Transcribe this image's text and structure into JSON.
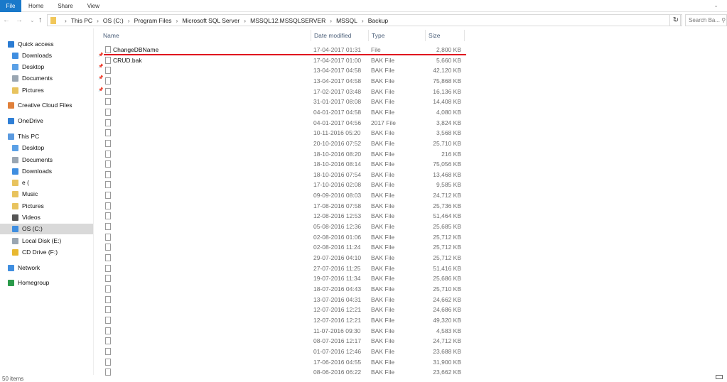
{
  "ribbon": {
    "tabs": [
      "File",
      "Home",
      "Share",
      "View"
    ]
  },
  "address": {
    "crumbs": [
      "This PC",
      "OS (C:)",
      "Program Files",
      "Microsoft SQL Server",
      "MSSQL12.MSSQLSERVER",
      "MSSQL",
      "Backup"
    ],
    "search_placeholder": "Search Ba..."
  },
  "sidebar": [
    {
      "label": "Quick access",
      "color": "#2b7cd3",
      "indent": 0,
      "pin": false
    },
    {
      "label": "Downloads",
      "color": "#3f8ee0",
      "indent": 1,
      "pin": true
    },
    {
      "label": "Desktop",
      "color": "#5aa0e6",
      "indent": 1,
      "pin": true
    },
    {
      "label": "Documents",
      "color": "#9aa6b2",
      "indent": 1,
      "pin": true
    },
    {
      "label": "Pictures",
      "color": "#e8c35e",
      "indent": 1,
      "pin": true
    },
    {
      "label": "Creative Cloud Files",
      "color": "#e0803a",
      "indent": 0,
      "pin": false
    },
    {
      "label": "OneDrive",
      "color": "#2f7fd6",
      "indent": 0,
      "pin": false
    },
    {
      "label": "This PC",
      "color": "#5a9ae0",
      "indent": 0,
      "pin": false
    },
    {
      "label": "Desktop",
      "color": "#5aa0e6",
      "indent": 1,
      "pin": false
    },
    {
      "label": "Documents",
      "color": "#9aa6b2",
      "indent": 1,
      "pin": false
    },
    {
      "label": "Downloads",
      "color": "#3f8ee0",
      "indent": 1,
      "pin": false
    },
    {
      "label": "e (",
      "color": "#e8c35e",
      "indent": 1,
      "pin": false
    },
    {
      "label": "Music",
      "color": "#e8c35e",
      "indent": 1,
      "pin": false
    },
    {
      "label": "Pictures",
      "color": "#e8c35e",
      "indent": 1,
      "pin": false
    },
    {
      "label": "Videos",
      "color": "#555555",
      "indent": 1,
      "pin": false
    },
    {
      "label": "OS (C:)",
      "color": "#3f8ee0",
      "indent": 1,
      "pin": false,
      "selected": true
    },
    {
      "label": "Local Disk (E:)",
      "color": "#9aa6b2",
      "indent": 1,
      "pin": false
    },
    {
      "label": "CD Drive (F:)",
      "color": "#e8b830",
      "indent": 1,
      "pin": false
    },
    {
      "label": "Network",
      "color": "#3f8ee0",
      "indent": 0,
      "pin": false
    },
    {
      "label": "Homegroup",
      "color": "#2b9a4a",
      "indent": 0,
      "pin": false
    }
  ],
  "columns": [
    "Name",
    "Date modified",
    "Type",
    "Size"
  ],
  "files": [
    [
      "ChangeDBName",
      "17-04-2017 01:31",
      "File",
      "2,800 KB"
    ],
    [
      "CRUD.bak",
      "17-04-2017 01:00",
      "BAK File",
      "5,660 KB"
    ],
    [
      "",
      "13-04-2017 04:58",
      "BAK File",
      "42,120 KB"
    ],
    [
      "",
      "13-04-2017 04:58",
      "BAK File",
      "75,868 KB"
    ],
    [
      "",
      "17-02-2017 03:48",
      "BAK File",
      "16,136 KB"
    ],
    [
      "",
      "31-01-2017 08:08",
      "BAK File",
      "14,408 KB"
    ],
    [
      "",
      "04-01-2017 04:58",
      "BAK File",
      "4,080 KB"
    ],
    [
      "",
      "04-01-2017 04:56",
      "2017 File",
      "3,824 KB"
    ],
    [
      "",
      "10-11-2016 05:20",
      "BAK File",
      "3,568 KB"
    ],
    [
      "",
      "20-10-2016 07:52",
      "BAK File",
      "25,710 KB"
    ],
    [
      "",
      "18-10-2016 08:20",
      "BAK File",
      "216 KB"
    ],
    [
      "",
      "18-10-2016 08:14",
      "BAK File",
      "75,056 KB"
    ],
    [
      "",
      "18-10-2016 07:54",
      "BAK File",
      "13,468 KB"
    ],
    [
      "",
      "17-10-2016 02:08",
      "BAK File",
      "9,585 KB"
    ],
    [
      "",
      "09-09-2016 08:03",
      "BAK File",
      "24,712 KB"
    ],
    [
      "",
      "17-08-2016 07:58",
      "BAK File",
      "25,736 KB"
    ],
    [
      "",
      "12-08-2016 12:53",
      "BAK File",
      "51,464 KB"
    ],
    [
      "",
      "05-08-2016 12:36",
      "BAK File",
      "25,685 KB"
    ],
    [
      "",
      "02-08-2016 01:06",
      "BAK File",
      "25,712 KB"
    ],
    [
      "",
      "02-08-2016 11:24",
      "BAK File",
      "25,712 KB"
    ],
    [
      "",
      "29-07-2016 04:10",
      "BAK File",
      "25,712 KB"
    ],
    [
      "",
      "27-07-2016 11:25",
      "BAK File",
      "51,416 KB"
    ],
    [
      "",
      "19-07-2016 11:34",
      "BAK File",
      "25,686 KB"
    ],
    [
      "",
      "18-07-2016 04:43",
      "BAK File",
      "25,710 KB"
    ],
    [
      "",
      "13-07-2016 04:31",
      "BAK File",
      "24,662 KB"
    ],
    [
      "",
      "12-07-2016 12:21",
      "BAK File",
      "24,686 KB"
    ],
    [
      "",
      "12-07-2016 12:21",
      "BAK File",
      "49,320 KB"
    ],
    [
      "",
      "11-07-2016 09:30",
      "BAK File",
      "4,583 KB"
    ],
    [
      "",
      "08-07-2016 12:17",
      "BAK File",
      "24,712 KB"
    ],
    [
      "",
      "01-07-2016 12:46",
      "BAK File",
      "23,688 KB"
    ],
    [
      "",
      "17-06-2016 04:55",
      "BAK File",
      "31,900 KB"
    ],
    [
      "",
      "08-06-2016 06:22",
      "BAK File",
      "23,662 KB"
    ]
  ],
  "status": "50 items"
}
